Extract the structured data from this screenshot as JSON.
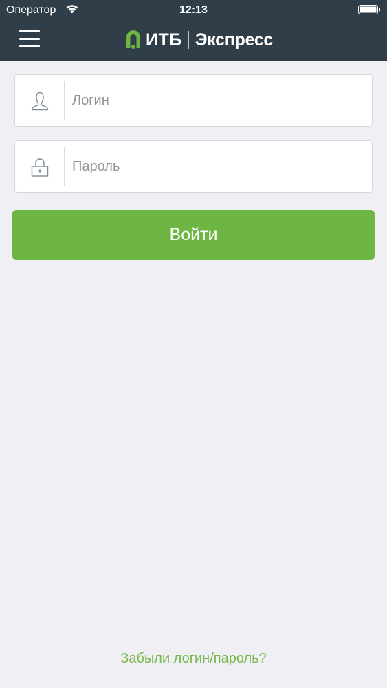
{
  "status_bar": {
    "carrier": "Оператор",
    "time": "12:13"
  },
  "header": {
    "logo_main": "ИТБ",
    "logo_sub": "Экспресс",
    "accent_color": "#6db644",
    "background_color": "#2f3e48"
  },
  "form": {
    "login": {
      "placeholder": "Логин",
      "value": "",
      "icon": "user-icon"
    },
    "password": {
      "placeholder": "Пароль",
      "value": "",
      "icon": "lock-icon"
    },
    "submit_label": "Войти"
  },
  "footer": {
    "forgot_label": "Забыли логин/пароль?"
  }
}
